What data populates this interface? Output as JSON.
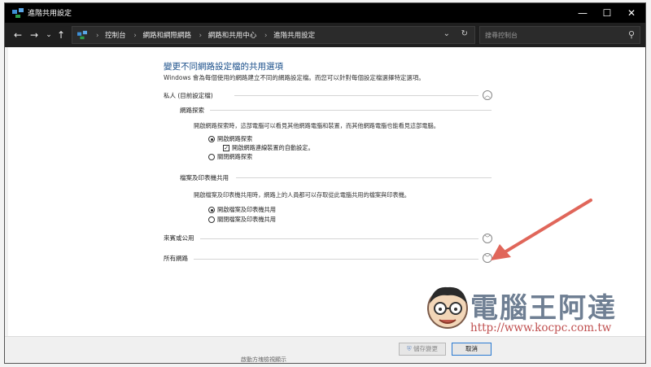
{
  "window": {
    "title": "進階共用設定",
    "controls": {
      "minimize": "—",
      "maximize": "☐",
      "close": "✕"
    }
  },
  "addressbar": {
    "nav": {
      "back": "←",
      "forward": "→",
      "recent": "⌄",
      "up": "↑"
    },
    "breadcrumbs": [
      "控制台",
      "網路和網際網路",
      "網路和共用中心",
      "進階共用設定"
    ],
    "search_placeholder": "搜尋控制台"
  },
  "main": {
    "heading": "變更不同網路設定檔的共用選項",
    "description": "Windows 會為每個使用的網路建立不同的網路設定檔。而您可以針對每個設定檔選擇特定選項。",
    "private_section": {
      "label": "私人 (目前設定檔)",
      "network_discovery": {
        "title": "網路探索",
        "text": "開啟網路探索時，這部電腦可以看見其他網路電腦和裝置，而其他網路電腦也能看見這部電腦。",
        "on_label": "開啟網路探索",
        "auto_setup_label": "開啟網路連線裝置的自動設定。",
        "off_label": "關閉網路探索",
        "selected": "on",
        "auto_setup_checked": true
      },
      "file_printer_sharing": {
        "title": "檔案及印表機共用",
        "text": "開啟檔案及印表機共用時，網路上的人員都可以存取從此電腦共用的檔案與印表機。",
        "on_label": "開啟檔案及印表機共用",
        "off_label": "關閉檔案及印表機共用",
        "selected": "on"
      }
    },
    "guest_public_label": "來賓或公用",
    "all_networks_label": "所有網路"
  },
  "footer": {
    "save_label": "儲存變更",
    "cancel_label": "取消"
  },
  "taskbar_hint": "啟動方塊檢視顯示",
  "watermark": {
    "brand": "電腦王阿達",
    "url": "http://www.kocpc.com.tw"
  },
  "colors": {
    "heading": "#1a4f8a",
    "arrow": "#e0665a",
    "cancel_border": "#2a7ad2"
  }
}
